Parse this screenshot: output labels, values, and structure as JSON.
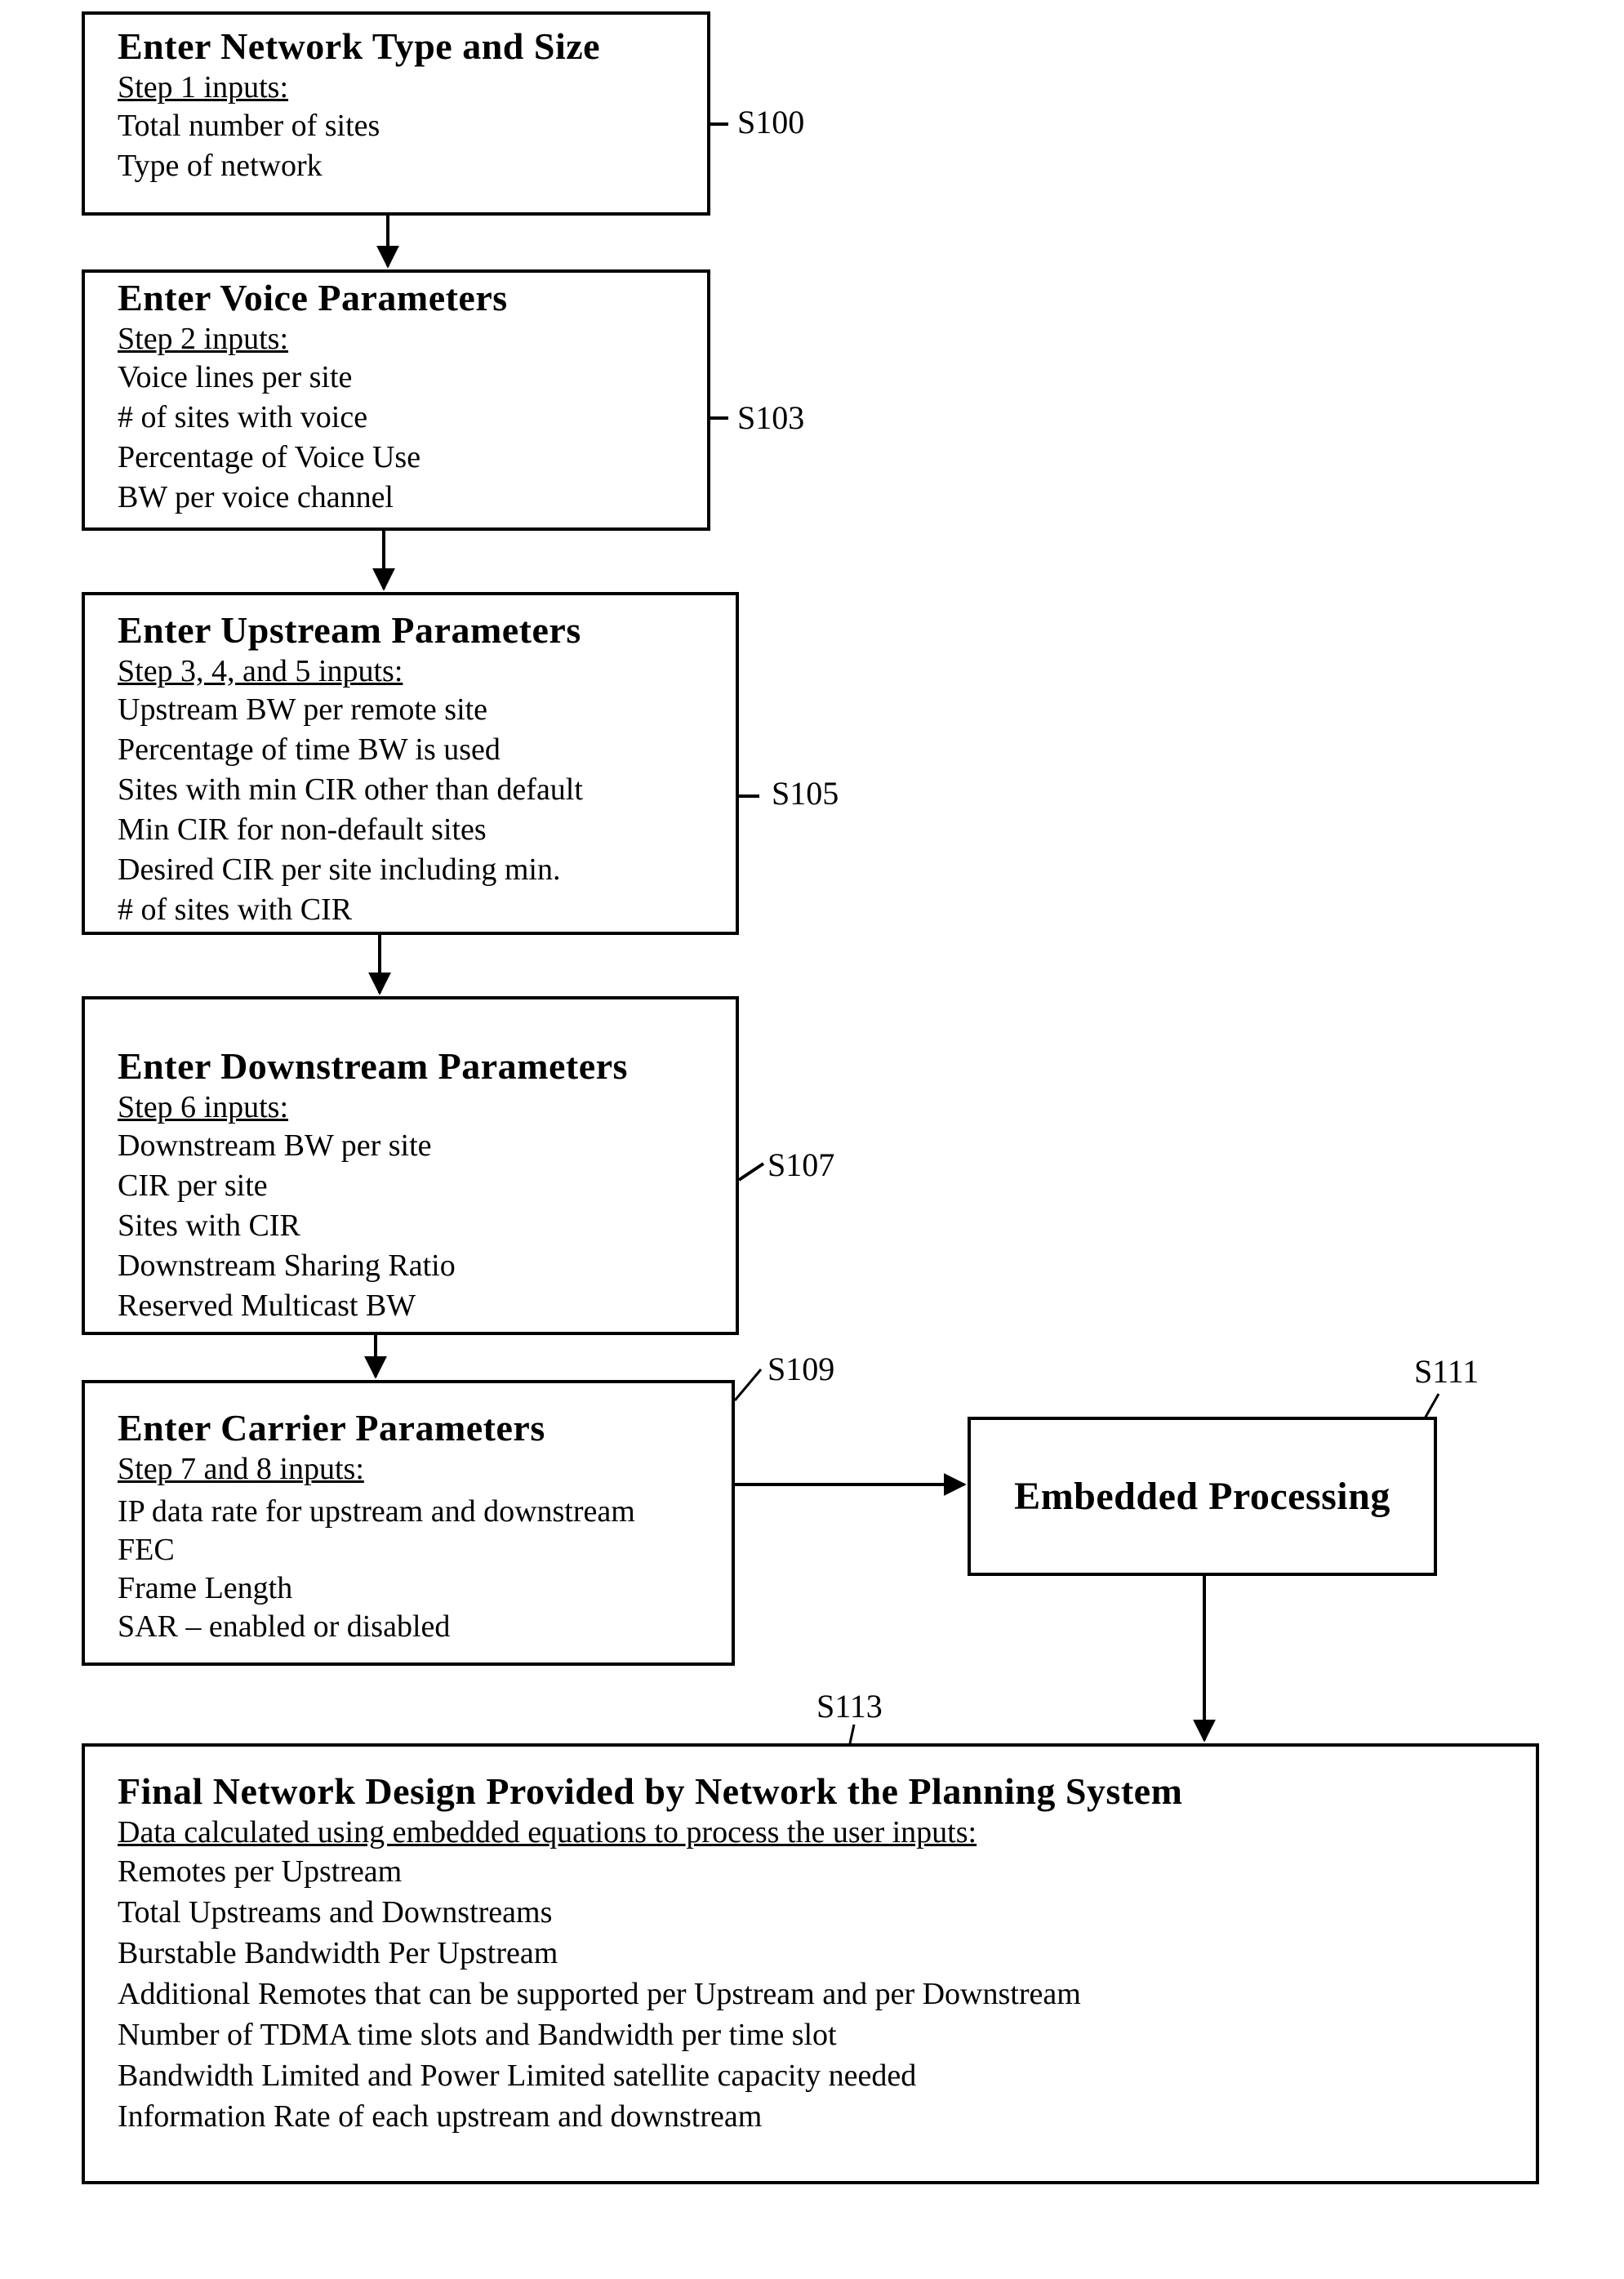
{
  "flowchart": {
    "steps": [
      {
        "ref": "S100",
        "title": "Enter Network Type and Size",
        "subtitle": "Step 1 inputs:",
        "items": [
          "Total number of sites",
          "Type of network"
        ]
      },
      {
        "ref": "S103",
        "title": "Enter Voice Parameters",
        "subtitle": "Step 2 inputs:",
        "items": [
          "Voice lines per site",
          "# of sites with voice",
          "Percentage of Voice Use",
          "BW per voice channel"
        ]
      },
      {
        "ref": "S105",
        "title": "Enter Upstream Parameters",
        "subtitle": "Step 3, 4, and 5 inputs:",
        "items": [
          "Upstream BW per remote site",
          "Percentage of time BW is used",
          "Sites with min CIR other than default",
          "Min CIR for non-default sites",
          "Desired CIR per site including min.",
          "# of sites with CIR"
        ]
      },
      {
        "ref": "S107",
        "title": "Enter Downstream Parameters",
        "subtitle": "Step 6 inputs:",
        "items": [
          "Downstream BW per site",
          "CIR per site",
          "Sites with CIR",
          "Downstream Sharing Ratio",
          "Reserved Multicast BW"
        ]
      },
      {
        "ref": "S109",
        "title": "Enter Carrier Parameters",
        "subtitle": "Step 7 and 8 inputs:",
        "items": [
          "IP data rate for upstream and downstream",
          "FEC",
          "Frame Length",
          "SAR – enabled or disabled"
        ]
      }
    ],
    "processing": {
      "ref": "S111",
      "title": "Embedded Processing"
    },
    "result": {
      "ref": "S113",
      "title": "Final Network Design Provided by Network the Planning System",
      "subtitle": "Data calculated using embedded equations to process the user inputs:",
      "items": [
        "Remotes per Upstream",
        "Total Upstreams and Downstreams",
        "Burstable Bandwidth Per Upstream",
        "Additional Remotes that can be supported per Upstream and per Downstream",
        "Number of TDMA time slots and Bandwidth per time slot",
        "Bandwidth Limited and Power Limited satellite capacity needed",
        "Information Rate of each upstream and downstream"
      ]
    },
    "edges": [
      {
        "from": "S100",
        "to": "S103"
      },
      {
        "from": "S103",
        "to": "S105"
      },
      {
        "from": "S105",
        "to": "S107"
      },
      {
        "from": "S107",
        "to": "S109"
      },
      {
        "from": "S109",
        "to": "S111"
      },
      {
        "from": "S111",
        "to": "S113"
      }
    ]
  }
}
